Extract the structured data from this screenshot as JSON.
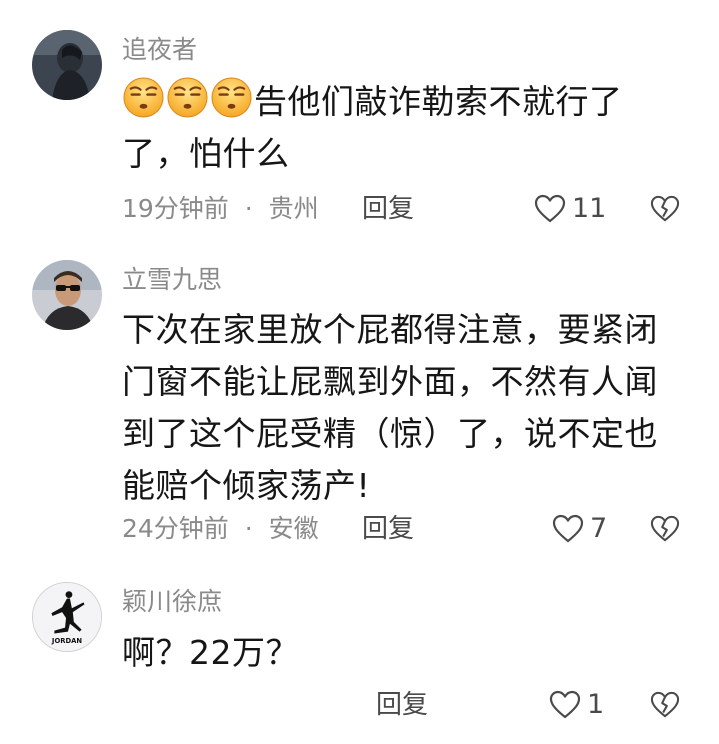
{
  "comments": [
    {
      "username": "追夜者",
      "emoji_count": 3,
      "lines": [
        "告他们敲诈勒索不就行了",
        "了，怕什么"
      ],
      "time": "19分钟前",
      "location": "贵州",
      "reply_label": "回复",
      "like_count": "11"
    },
    {
      "username": "立雪九思",
      "lines": [
        "下次在家里放个屁都得注意，要紧闭",
        "门窗不能让屁飘到外面，不然有人闻",
        "到了这个屁受精（惊）了，说不定也",
        "能赔个倾家荡产!"
      ],
      "time": "24分钟前",
      "location": "安徽",
      "reply_label": "回复",
      "like_count": "7"
    },
    {
      "username": "颖川徐庶",
      "lines": [
        "啊？22万？"
      ],
      "reply_label": "回复",
      "like_count": "1",
      "avatar_text": "JORDAN"
    }
  ],
  "meta_separator": "·",
  "icons": {
    "emoji": "smirk-emoji-icon",
    "like": "heart-outline-icon",
    "dislike": "broken-heart-icon"
  },
  "colors": {
    "meta_gray": "#8a8a8a",
    "text": "#161616",
    "icon": "#4a4a4a"
  }
}
